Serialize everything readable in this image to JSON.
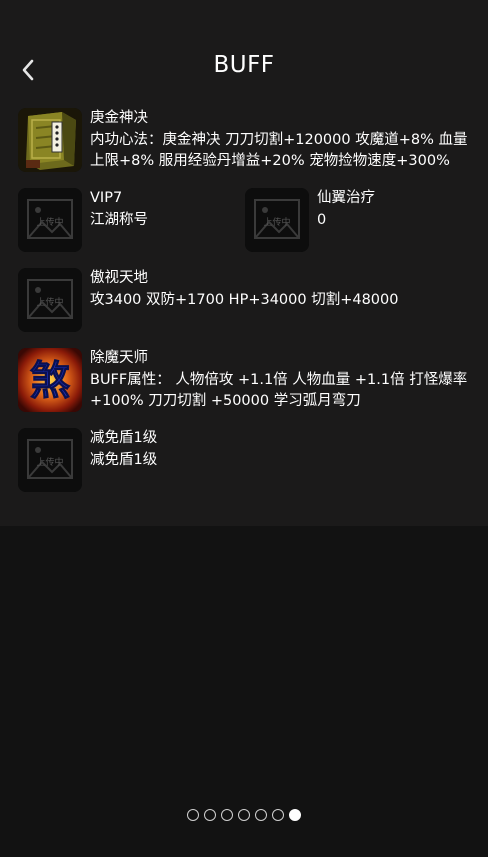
{
  "header": {
    "title": "BUFF",
    "back_icon": "chevron-left-icon"
  },
  "buffs": {
    "item1": {
      "icon": "book-icon",
      "name": "庚金神决",
      "desc": "内功心法：庚金神决 刀刀切割+120000 攻魔道+8% 血量上限+8% 服用经验丹增益+20% 宠物捡物速度+300%"
    },
    "item2": {
      "icon": "image-placeholder-icon",
      "name": "VIP7",
      "desc": "江湖称号"
    },
    "item3": {
      "icon": "image-placeholder-icon",
      "name": "仙翼治疗",
      "desc": "0"
    },
    "item4": {
      "icon": "image-placeholder-icon",
      "name": "傲视天地",
      "desc": "攻3400 双防+1700 HP+34000 切割+48000"
    },
    "item5": {
      "icon": "kanji-emblem-icon",
      "emblem_text": "煞",
      "name": "除魔天师",
      "desc": "BUFF属性： 人物倍攻 +1.1倍 人物血量 +1.1倍 打怪爆率+100% 刀刀切割 +50000 学习弧月弯刀"
    },
    "item6": {
      "icon": "image-placeholder-icon",
      "name": "减免盾1级",
      "desc": "减免盾1级"
    },
    "placeholder_text": "上传中"
  },
  "pager": {
    "total": 7,
    "active_index": 6
  },
  "colors": {
    "panel": "#1b1a1a",
    "background": "#121212",
    "text": "#ffffff"
  }
}
